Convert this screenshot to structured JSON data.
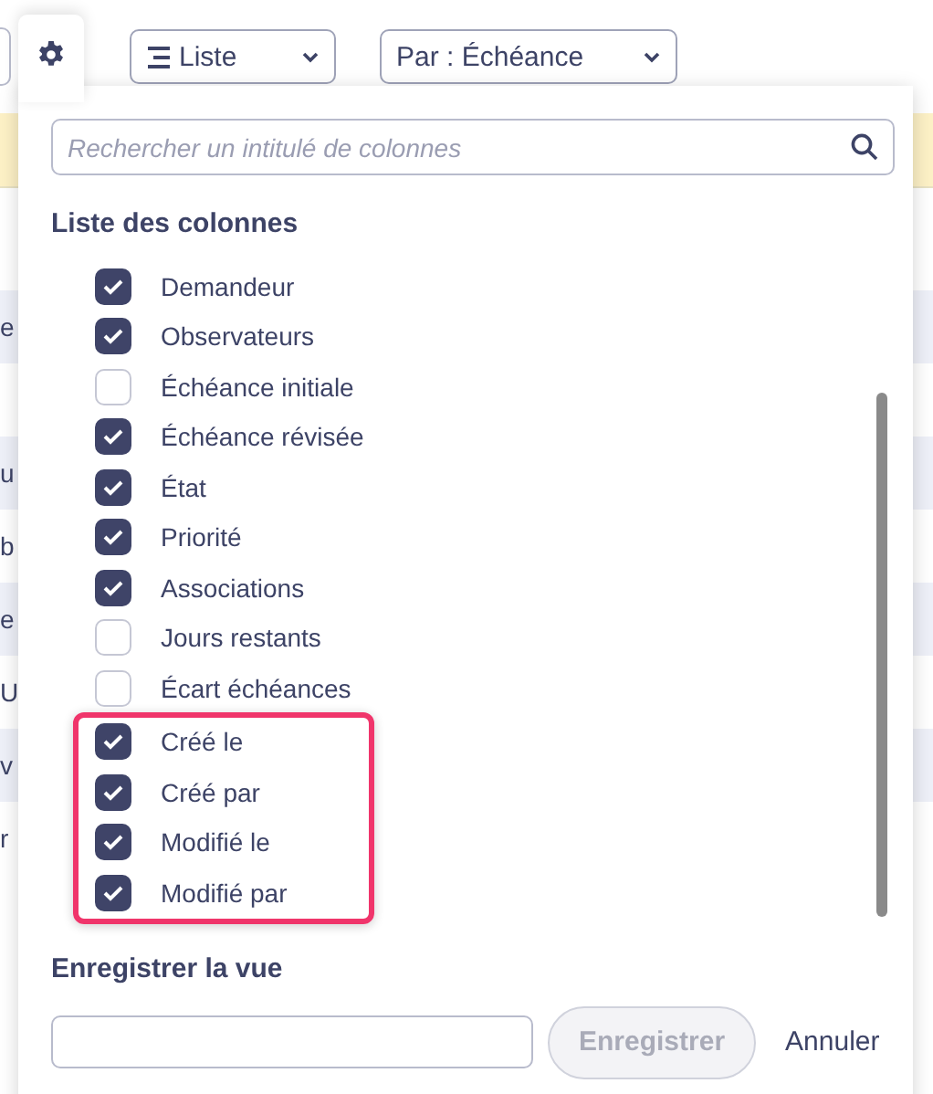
{
  "toolbar": {
    "view_select": {
      "value": "Liste"
    },
    "sort_select": {
      "value": "Par : Échéance"
    }
  },
  "background_rows": [
    {
      "text": "e"
    },
    {},
    {
      "text": "u"
    },
    {
      "text": "b"
    },
    {
      "text": "e"
    },
    {
      "text": "U"
    },
    {
      "text": "v"
    },
    {
      "text": "r"
    }
  ],
  "column_panel": {
    "search": {
      "placeholder": "Rechercher un intitulé de colonnes"
    },
    "heading": "Liste des colonnes",
    "columns": [
      {
        "label": "Demandeur",
        "checked": true,
        "highlighted": false
      },
      {
        "label": "Observateurs",
        "checked": true,
        "highlighted": false
      },
      {
        "label": "Échéance initiale",
        "checked": false,
        "highlighted": false
      },
      {
        "label": "Échéance révisée",
        "checked": true,
        "highlighted": false
      },
      {
        "label": "État",
        "checked": true,
        "highlighted": false
      },
      {
        "label": "Priorité",
        "checked": true,
        "highlighted": false
      },
      {
        "label": "Associations",
        "checked": true,
        "highlighted": false
      },
      {
        "label": "Jours restants",
        "checked": false,
        "highlighted": false
      },
      {
        "label": "Écart échéances",
        "checked": false,
        "highlighted": false
      },
      {
        "label": "Créé le",
        "checked": true,
        "highlighted": true
      },
      {
        "label": "Créé par",
        "checked": true,
        "highlighted": true
      },
      {
        "label": "Modifié le",
        "checked": true,
        "highlighted": true
      },
      {
        "label": "Modifié par",
        "checked": true,
        "highlighted": true
      }
    ],
    "save_view": {
      "heading": "Enregistrer la vue",
      "save_button": {
        "label": "Enregistrer",
        "disabled": true
      },
      "cancel_link": "Annuler"
    }
  }
}
